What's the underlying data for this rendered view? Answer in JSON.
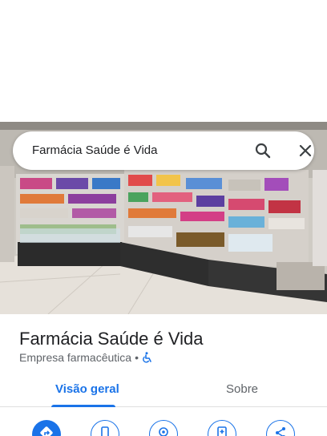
{
  "search": {
    "query": "Farmácia Saúde é Vida"
  },
  "place": {
    "name": "Farmácia Saúde é Vida",
    "category": "Empresa farmacêutica",
    "separator": "•"
  },
  "tabs": [
    {
      "label": "Visão geral",
      "selected": true
    },
    {
      "label": "Sobre",
      "selected": false
    }
  ],
  "actions": [
    {
      "icon": "directions-icon"
    },
    {
      "icon": "phone-icon"
    },
    {
      "icon": "location-pin-icon"
    },
    {
      "icon": "save-icon"
    },
    {
      "icon": "share-icon"
    }
  ],
  "colors": {
    "accent": "#1a73e8",
    "text": "#202124",
    "secondary_text": "#5f6368"
  }
}
